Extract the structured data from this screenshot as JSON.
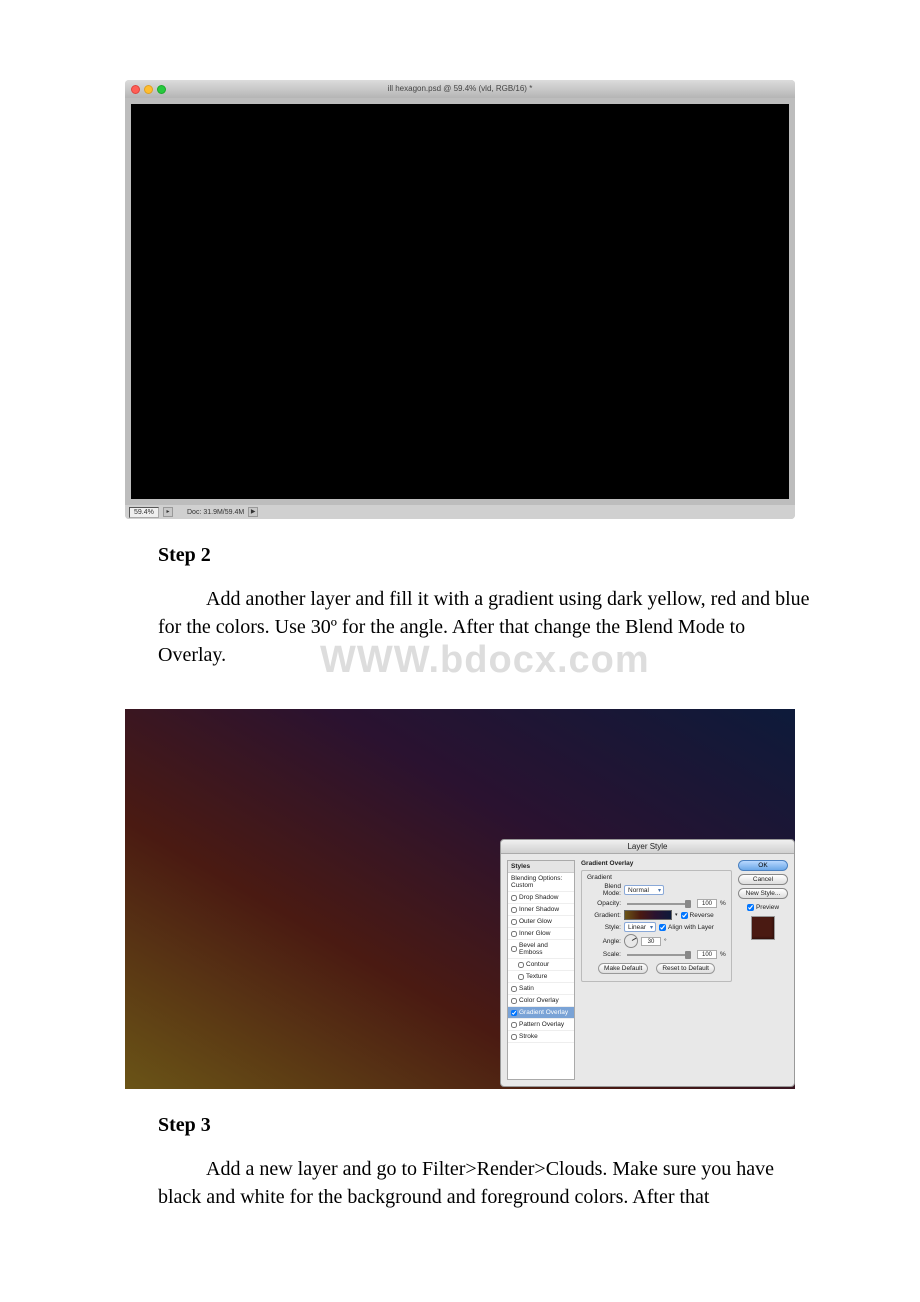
{
  "figure1": {
    "window_title": "ill hexagon.psd @ 59.4% (vld, RGB/16) *",
    "zoom": "59.4%",
    "doc_info": "Doc: 31.9M/59.4M",
    "arrow": "▶"
  },
  "step2": {
    "heading": "Step 2",
    "text": "Add another layer and fill it with a gradient using dark yellow, red and blue for the colors. Use 30º for the angle. After that change the Blend Mode to Overlay."
  },
  "watermark": "WWW.bdocx.com",
  "layerstyle": {
    "title": "Layer Style",
    "sidebar_header": "Styles",
    "blending_options": "Blending Options: Custom",
    "items": [
      {
        "label": "Drop Shadow",
        "checked": false
      },
      {
        "label": "Inner Shadow",
        "checked": false
      },
      {
        "label": "Outer Glow",
        "checked": false
      },
      {
        "label": "Inner Glow",
        "checked": false
      },
      {
        "label": "Bevel and Emboss",
        "checked": false
      },
      {
        "label": "Contour",
        "checked": false
      },
      {
        "label": "Texture",
        "checked": false
      },
      {
        "label": "Satin",
        "checked": false
      },
      {
        "label": "Color Overlay",
        "checked": false
      },
      {
        "label": "Gradient Overlay",
        "checked": true,
        "active": true
      },
      {
        "label": "Pattern Overlay",
        "checked": false
      },
      {
        "label": "Stroke",
        "checked": false
      }
    ],
    "group_title": "Gradient Overlay",
    "subgroup": "Gradient",
    "blend_mode_label": "Blend Mode:",
    "blend_mode_value": "Normal",
    "opacity_label": "Opacity:",
    "opacity_value": "100",
    "pct": "%",
    "gradient_label": "Gradient:",
    "reverse_label": "Reverse",
    "style_label": "Style:",
    "style_value": "Linear",
    "align_label": "Align with Layer",
    "angle_label": "Angle:",
    "angle_value": "30",
    "deg": "°",
    "scale_label": "Scale:",
    "scale_value": "100",
    "make_default": "Make Default",
    "reset_default": "Reset to Default",
    "buttons": {
      "ok": "OK",
      "cancel": "Cancel",
      "new_style": "New Style...",
      "preview": "Preview"
    }
  },
  "step3": {
    "heading": "Step 3",
    "text": "Add a new layer and go to Filter>Render>Clouds. Make sure you have black and white for the background and foreground colors. After that"
  }
}
